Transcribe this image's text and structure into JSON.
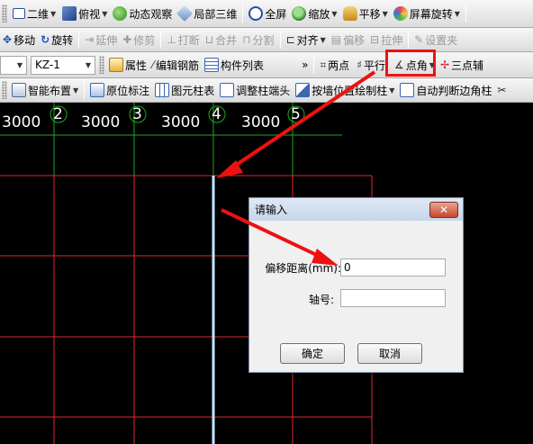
{
  "toolbar1": {
    "view2d_label": "二维",
    "topview_label": "俯视",
    "orbit_label": "动态观察",
    "local3d_label": "局部三维",
    "fullscreen_label": "全屏",
    "zoom_label": "缩放",
    "pan_label": "平移",
    "rotate_screen_label": "屏幕旋转"
  },
  "toolbar2": {
    "move_label": "移动",
    "rotate_label": "旋转",
    "extend_label": "延伸",
    "trim_label": "修剪",
    "break_label": "打断",
    "merge_label": "合并",
    "split_label": "分割",
    "align_label": "对齐",
    "offset_label": "偏移",
    "stretch_label": "拉伸",
    "set_label": "设置夹"
  },
  "toolbar3": {
    "component_select": "KZ-1",
    "properties_label": "属性",
    "edit_rebar_label": "编辑钢筋",
    "component_list_label": "构件列表",
    "two_point_label": "两点",
    "parallel_label": "平行",
    "point_angle_label": "点角",
    "three_point_label": "三点辅"
  },
  "toolbar4": {
    "smart_layout_label": "智能布置",
    "in_situ_mark_label": "原位标注",
    "element_column_table_label": "图元柱表",
    "adjust_column_end_label": "调整柱端头",
    "draw_by_position_label": "按墙位置绘制柱",
    "auto_edge_column_label": "自动判断边角柱"
  },
  "canvas": {
    "grid_numbers": [
      "2",
      "3",
      "4",
      "5"
    ],
    "spacings": [
      "3000",
      "3000",
      "3000",
      "3000"
    ]
  },
  "dialog": {
    "title": "请输入",
    "close_label": "✕",
    "offset_label": "偏移距离(mm):",
    "offset_value": "0",
    "axis_label": "轴号:",
    "axis_value": "",
    "ok_label": "确定",
    "cancel_label": "取消"
  },
  "colors": {
    "grid_red": "#e0282e",
    "grid_green": "#1ea81e",
    "highlight_red": "#e11111",
    "aux_line": "#bfe9ff"
  },
  "icons": [
    "view2d-icon",
    "topview-icon",
    "orbit-icon",
    "local3d-icon",
    "fullscreen-icon",
    "zoom-icon",
    "pan-icon",
    "rotate-screen-icon",
    "move-icon",
    "rotate-icon",
    "extend-icon",
    "trim-icon",
    "break-icon",
    "merge-icon",
    "split-icon",
    "align-icon",
    "offset-icon",
    "stretch-icon",
    "set-icon",
    "properties-icon",
    "edit-rebar-icon",
    "component-list-icon",
    "two-point-icon",
    "parallel-icon",
    "point-angle-icon",
    "three-point-icon",
    "smart-layout-icon",
    "in-situ-mark-icon",
    "column-table-icon",
    "adjust-end-icon",
    "draw-by-position-icon",
    "auto-edge-icon",
    "close-icon"
  ]
}
